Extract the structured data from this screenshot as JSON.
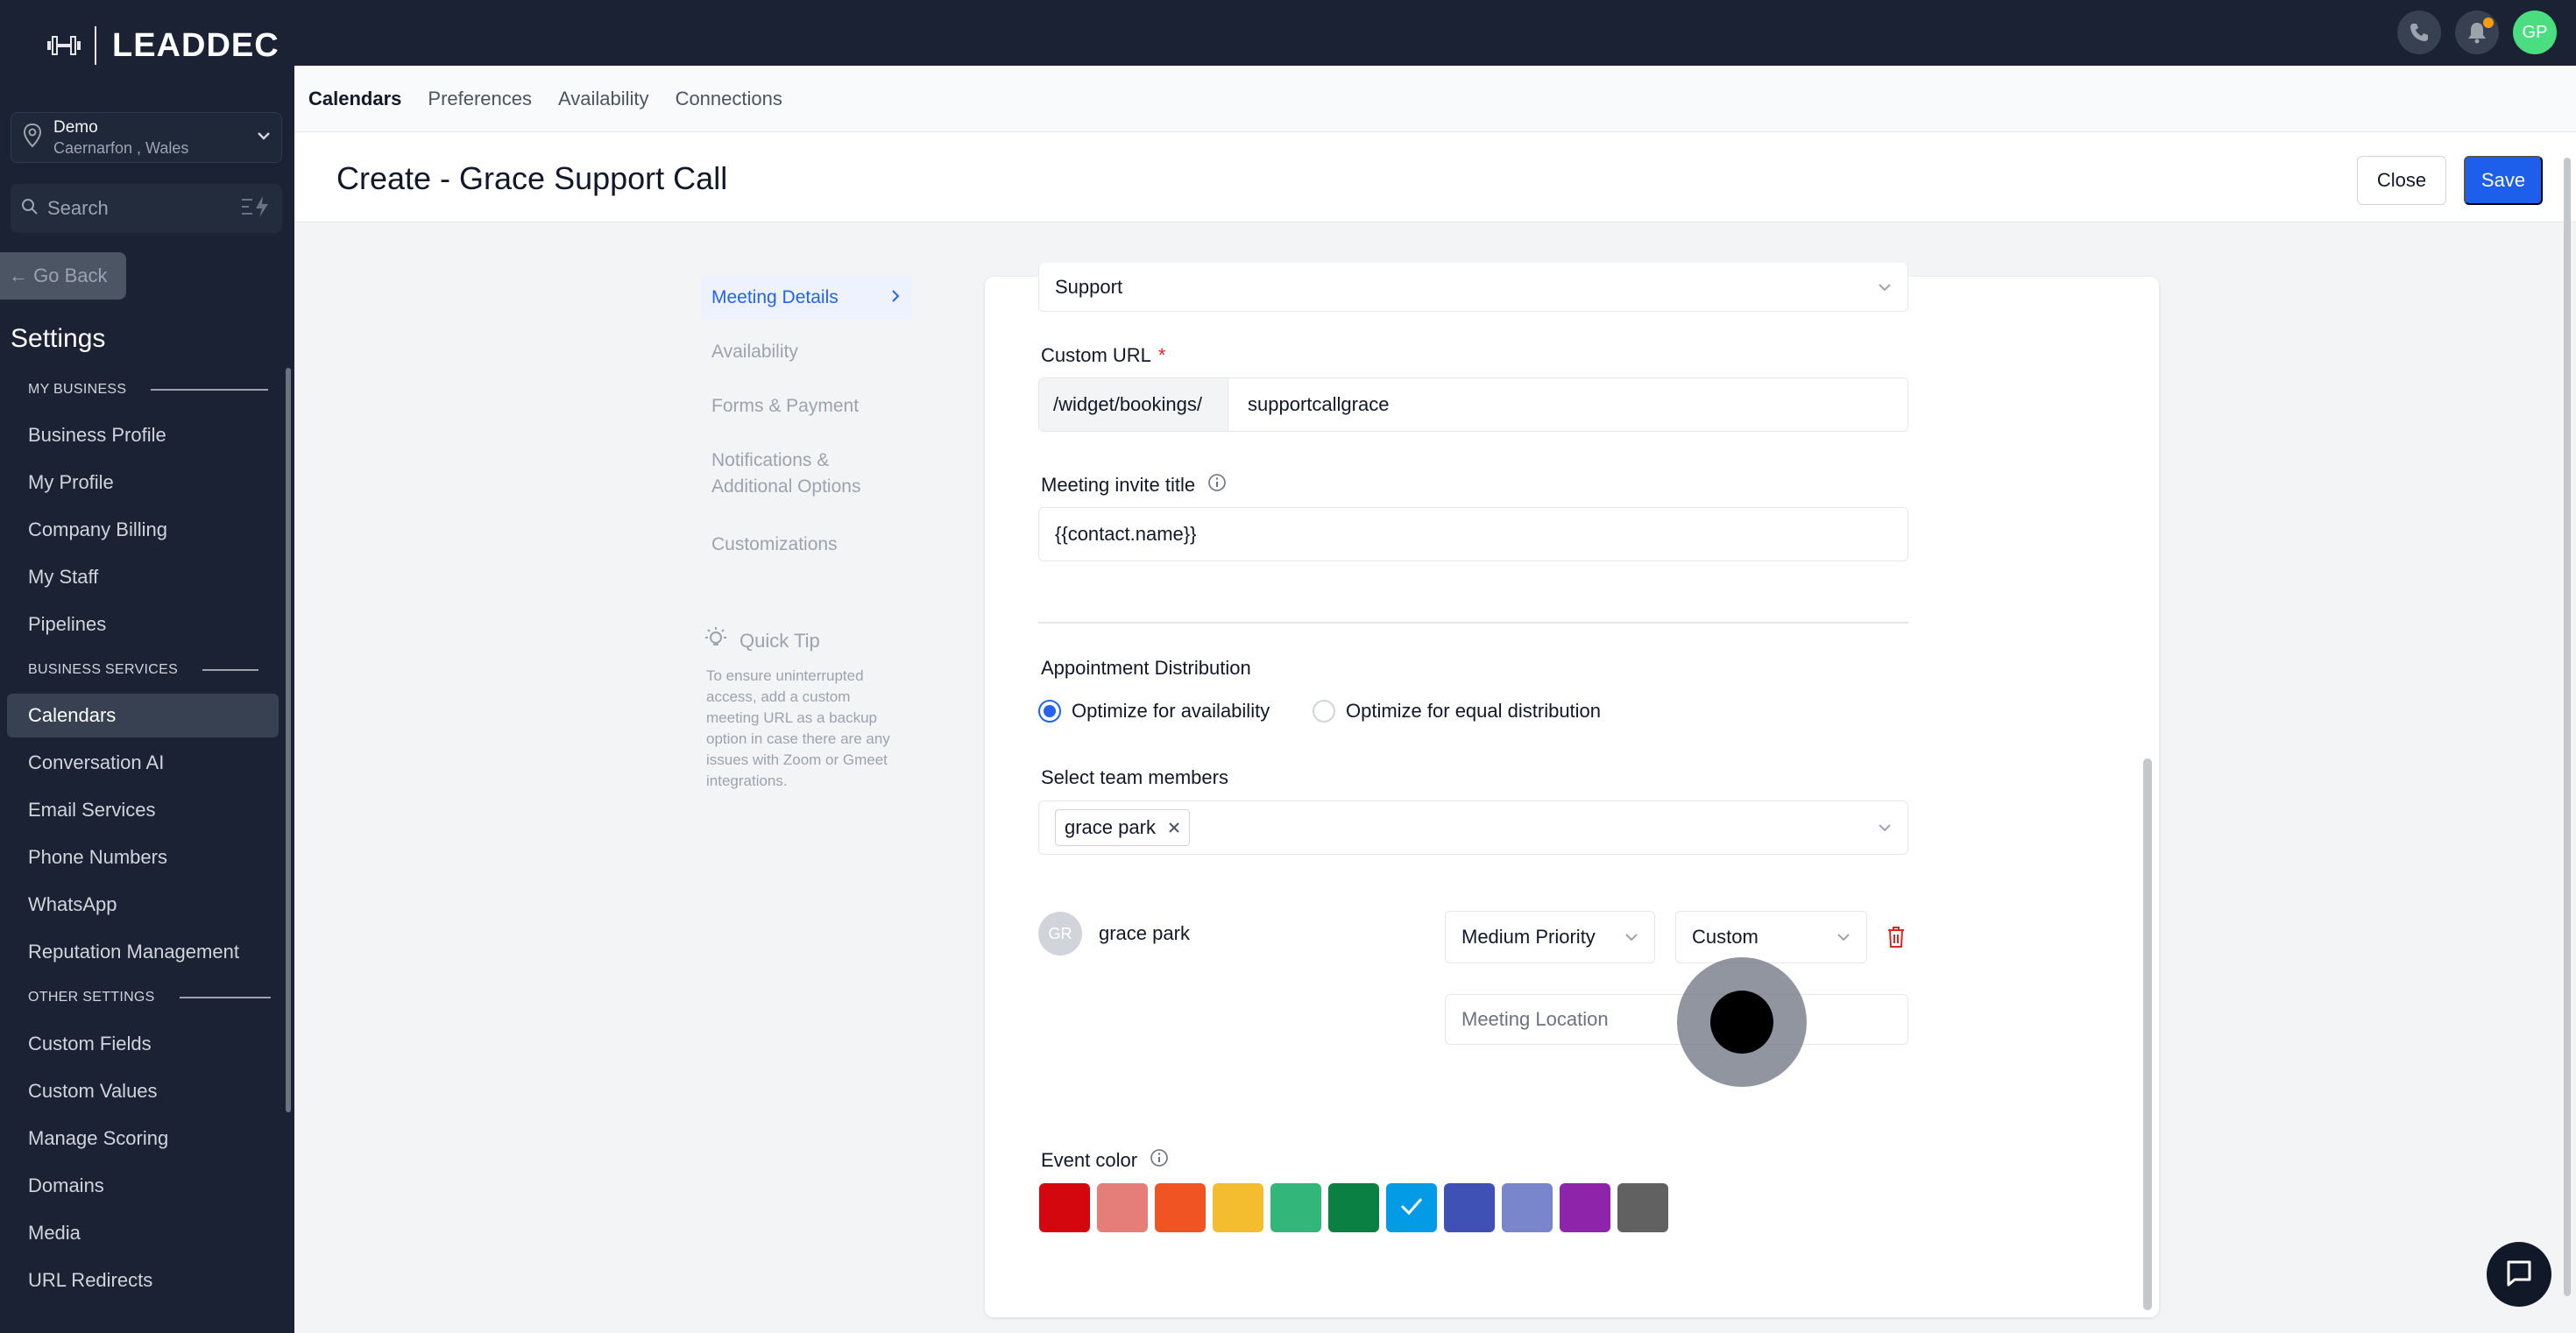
{
  "brand": {
    "name": "LEADDEC"
  },
  "location": {
    "name": "Demo",
    "sub": "Caernarfon , Wales"
  },
  "sidebar": {
    "search_placeholder": "Search",
    "go_back": "← Go Back",
    "settings_title": "Settings",
    "sections": {
      "my_business": "MY BUSINESS",
      "business_services": "BUSINESS SERVICES",
      "other_settings": "OTHER SETTINGS"
    },
    "items": [
      "Business Profile",
      "My Profile",
      "Company Billing",
      "My Staff",
      "Pipelines",
      "Calendars",
      "Conversation AI",
      "Email Services",
      "Phone Numbers",
      "WhatsApp",
      "Reputation Management",
      "Custom Fields",
      "Custom Values",
      "Manage Scoring",
      "Domains",
      "Media",
      "URL Redirects"
    ],
    "active_item": "Calendars"
  },
  "topbar": {
    "avatar_initials": "GP"
  },
  "tabs": [
    "Calendars",
    "Preferences",
    "Availability",
    "Connections"
  ],
  "header": {
    "title": "Create - Grace Support Call",
    "close_label": "Close",
    "save_label": "Save"
  },
  "steps": {
    "items": [
      "Meeting Details",
      "Availability",
      "Forms & Payment",
      "Notifications & Additional Options",
      "Customizations"
    ],
    "active": "Meeting Details"
  },
  "quick_tip": {
    "title": "Quick Tip",
    "body": "To ensure uninterrupted access, add a custom meeting URL as a backup option in case there are any issues with Zoom or Gmeet integrations."
  },
  "form": {
    "group_value": "Support",
    "custom_url": {
      "label": "Custom URL",
      "required_mark": "*",
      "prefix": "/widget/bookings/",
      "value": "supportcallgrace"
    },
    "invite_title": {
      "label": "Meeting invite title",
      "value": "{{contact.name}}"
    },
    "distribution": {
      "label": "Appointment Distribution",
      "options": [
        "Optimize for availability",
        "Optimize for equal distribution"
      ],
      "selected": "Optimize for availability"
    },
    "team": {
      "label": "Select team members",
      "chips": [
        "grace park"
      ]
    },
    "member": {
      "initials": "GR",
      "name": "grace park",
      "priority": "Medium Priority",
      "location_type": "Custom",
      "location_placeholder": "Meeting Location"
    },
    "event_color": {
      "label": "Event color",
      "colors": [
        "#d5070e",
        "#e57e78",
        "#f05423",
        "#f4bd2f",
        "#33b679",
        "#0b8043",
        "#039be5",
        "#3f51b5",
        "#7986cb",
        "#8e24aa",
        "#616161"
      ],
      "selected_index": 6
    }
  },
  "colors": {
    "accent": "#1d5eea",
    "sidebar_bg": "#1a2233"
  }
}
